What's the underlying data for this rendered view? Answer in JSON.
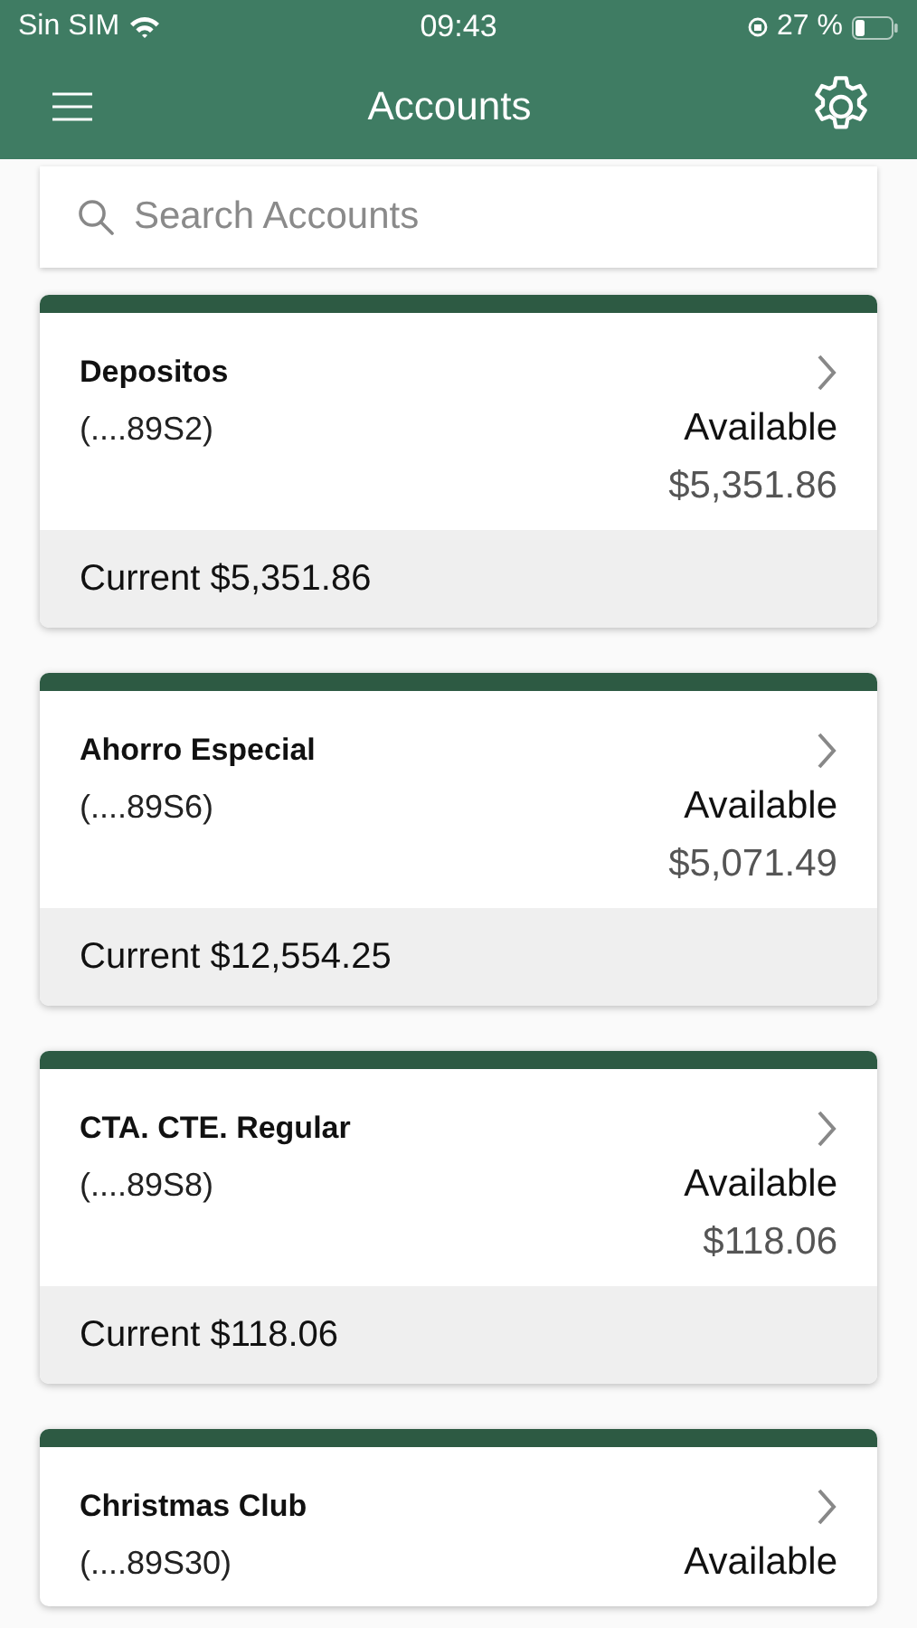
{
  "status_bar": {
    "carrier": "Sin SIM",
    "time": "09:43",
    "battery_text": "27 %"
  },
  "header": {
    "title": "Accounts"
  },
  "search": {
    "placeholder": "Search Accounts"
  },
  "accounts": [
    {
      "name": "Depositos",
      "number": "(....89S2)",
      "available_label": "Available",
      "available_amount": "$5,351.86",
      "current": "Current $5,351.86"
    },
    {
      "name": "Ahorro Especial",
      "number": "(....89S6)",
      "available_label": "Available",
      "available_amount": "$5,071.49",
      "current": "Current $12,554.25"
    },
    {
      "name": "CTA. CTE. Regular",
      "number": "(....89S8)",
      "available_label": "Available",
      "available_amount": "$118.06",
      "current": "Current $118.06"
    },
    {
      "name": "Christmas Club",
      "number": "(....89S30)",
      "available_label": "Available"
    }
  ]
}
